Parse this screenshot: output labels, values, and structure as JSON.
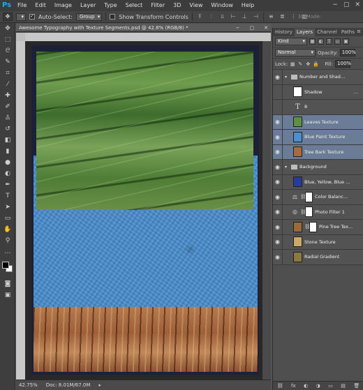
{
  "app": {
    "logo": "Ps"
  },
  "menu": [
    "File",
    "Edit",
    "Image",
    "Layer",
    "Type",
    "Select",
    "Filter",
    "3D",
    "View",
    "Window",
    "Help"
  ],
  "window_controls": [
    "−",
    "▢",
    "✕"
  ],
  "options": {
    "auto_select_label": "Auto-Select:",
    "auto_select_checked": true,
    "auto_select_value": "Group",
    "show_transform_label": "Show Transform Controls",
    "show_transform_checked": false,
    "mode_3d_label": "3D Mode:"
  },
  "document": {
    "tab_title": "Awesome Typography with Texture Segments.psd @ 42.8% (RGB/8) *",
    "tab_controls": [
      "−",
      "▢",
      "✕"
    ]
  },
  "status": {
    "zoom": "42.75%",
    "doc_size": "Doc: 8.01M/67.0M"
  },
  "panel": {
    "tabs": [
      "History",
      "Layers",
      "Channel",
      "Paths"
    ],
    "active_tab": "Layers",
    "kind_label": "Kind",
    "blend_mode": "Normal",
    "opacity_label": "Opacity:",
    "opacity_value": "100%",
    "lock_label": "Lock:",
    "fill_label": "Fill:",
    "fill_value": "100%"
  },
  "layers": [
    {
      "name": "Number and Shadow",
      "type": "group",
      "visible": true,
      "selected": false,
      "indent": 0
    },
    {
      "name": "Shadow",
      "type": "image",
      "visible": false,
      "selected": false,
      "indent": 1,
      "thumb": "#ffffff",
      "fx": "..."
    },
    {
      "name": "8",
      "type": "text",
      "visible": false,
      "selected": false,
      "indent": 1
    },
    {
      "name": "Leaves Texture",
      "type": "image",
      "visible": true,
      "selected": true,
      "indent": 1,
      "thumb": "#5f8e45"
    },
    {
      "name": "Blue Paint Texture",
      "type": "image",
      "visible": true,
      "selected": true,
      "indent": 1,
      "thumb": "#4a8fcf"
    },
    {
      "name": "Tree Bark Texture",
      "type": "image",
      "visible": true,
      "selected": true,
      "indent": 1,
      "thumb": "#a86a40"
    },
    {
      "name": "Background",
      "type": "group",
      "visible": true,
      "selected": false,
      "indent": 0
    },
    {
      "name": "Blue, Yellow, Blue Gr...",
      "type": "image",
      "visible": true,
      "selected": false,
      "indent": 1,
      "thumb": "#2a3c9a"
    },
    {
      "name": "Color Balanc...",
      "type": "adjustment",
      "visible": true,
      "selected": false,
      "indent": 1,
      "icon": "⚖"
    },
    {
      "name": "Photo Filter 1",
      "type": "adjustment",
      "visible": true,
      "selected": false,
      "indent": 1,
      "icon": "◎"
    },
    {
      "name": "Pine Tree Tex...",
      "type": "masked",
      "visible": true,
      "selected": false,
      "indent": 1,
      "thumb": "#9b6a3a"
    },
    {
      "name": "Stone Texture",
      "type": "image",
      "visible": true,
      "selected": false,
      "indent": 1,
      "thumb": "#c9a86a"
    },
    {
      "name": "Radial Gradient",
      "type": "image",
      "visible": true,
      "selected": false,
      "indent": 1,
      "thumb": "#8a7a40"
    }
  ],
  "footer_icons": [
    "⛓",
    "fx",
    "◐",
    "◑",
    "▭",
    "▤",
    "🗑"
  ],
  "colors": {
    "selection": "#6a7c96",
    "canvas_bg": "#1d2039",
    "workspace": "#282828"
  }
}
